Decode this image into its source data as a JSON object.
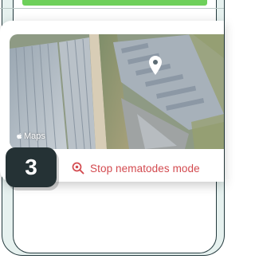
{
  "map": {
    "brand_label": "Maps",
    "brand_icon": "apple-logo-icon",
    "pin_icon": "location-pin-icon"
  },
  "action": {
    "label": "Stop nematodes mode",
    "icon": "zoom-icon",
    "color": "#d34a4f"
  },
  "step": {
    "number": "3"
  },
  "colors": {
    "accent_tab": "#6dd05a",
    "frame_bg": "#e6f1ef",
    "badge_bg": "#253235"
  }
}
